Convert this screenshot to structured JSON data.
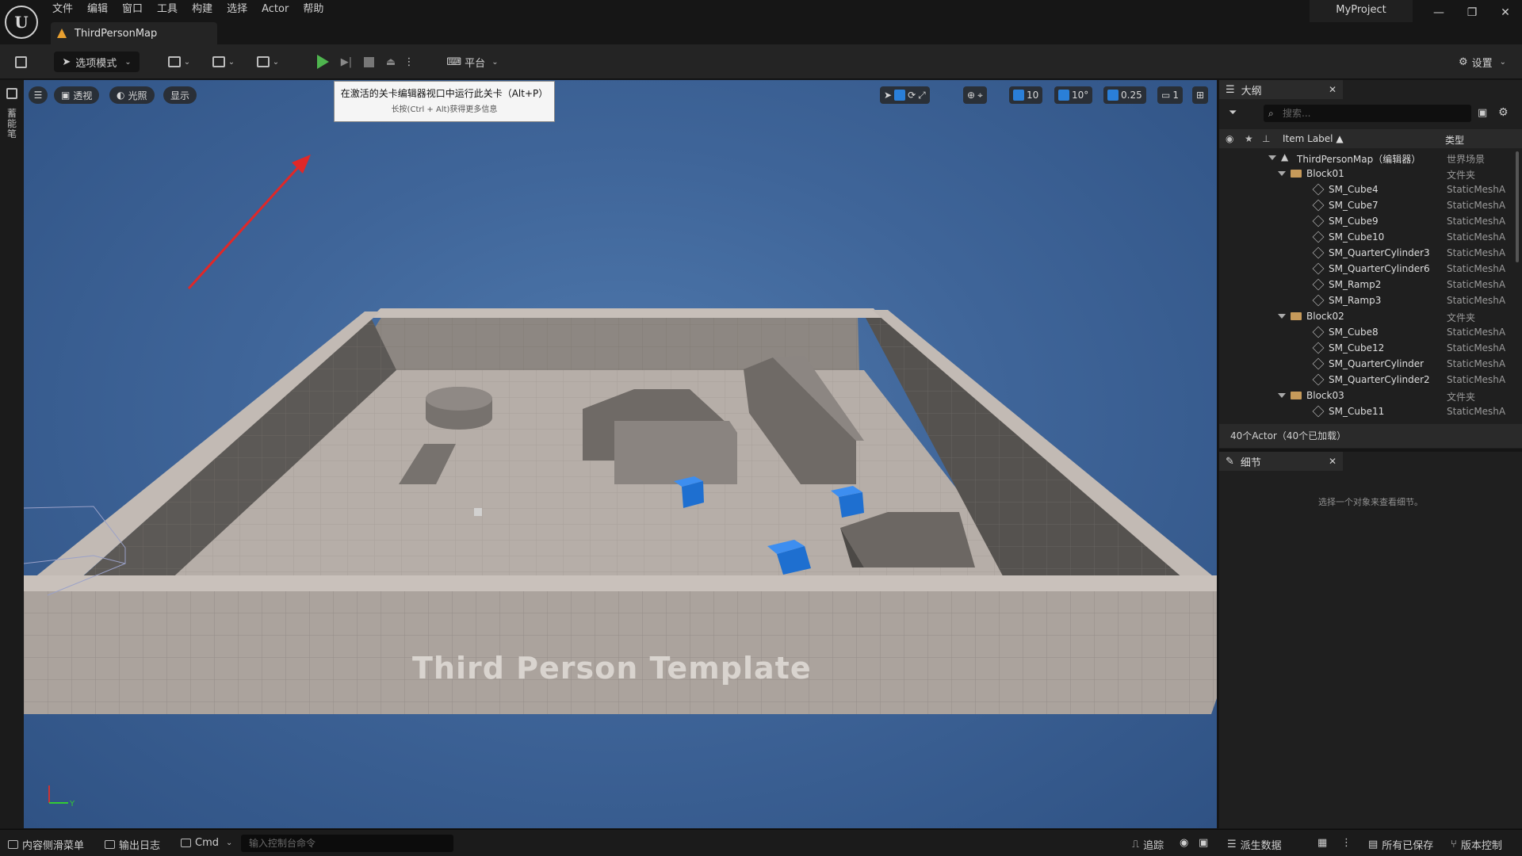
{
  "menubar": {
    "items": [
      "文件",
      "编辑",
      "窗口",
      "工具",
      "构建",
      "选择",
      "Actor",
      "帮助"
    ]
  },
  "tab": {
    "map_name": "ThirdPersonMap"
  },
  "project_name": "MyProject",
  "toolbar": {
    "mode_label": "选项模式",
    "platform_label": "平台",
    "settings_label": "设置"
  },
  "left_strip": {
    "label": "蓄能笔"
  },
  "viewport": {
    "view_mode": "透视",
    "lighting": "光照",
    "show": "显示",
    "grid_snap": "10",
    "rotation_snap": "10°",
    "scale_snap": "0.25",
    "camera_speed": "1",
    "floor_text": "Third Person Template"
  },
  "tooltip": {
    "title": "在激活的关卡编辑器视口中运行此关卡（Alt+P）",
    "hint": "长按(Ctrl + Alt)获得更多信息"
  },
  "outliner": {
    "title": "大纲",
    "search_placeholder": "搜索...",
    "col_label": "Item Label ▲",
    "col_type": "类型",
    "rows": [
      {
        "label": "ThirdPersonMap（编辑器）",
        "type": "世界场景",
        "level": 0,
        "kind": "world"
      },
      {
        "label": "Block01",
        "type": "文件夹",
        "level": 1,
        "kind": "folder"
      },
      {
        "label": "SM_Cube4",
        "type": "StaticMeshA",
        "level": 2,
        "kind": "mesh"
      },
      {
        "label": "SM_Cube7",
        "type": "StaticMeshA",
        "level": 2,
        "kind": "mesh"
      },
      {
        "label": "SM_Cube9",
        "type": "StaticMeshA",
        "level": 2,
        "kind": "mesh"
      },
      {
        "label": "SM_Cube10",
        "type": "StaticMeshA",
        "level": 2,
        "kind": "mesh"
      },
      {
        "label": "SM_QuarterCylinder3",
        "type": "StaticMeshA",
        "level": 2,
        "kind": "mesh"
      },
      {
        "label": "SM_QuarterCylinder6",
        "type": "StaticMeshA",
        "level": 2,
        "kind": "mesh"
      },
      {
        "label": "SM_Ramp2",
        "type": "StaticMeshA",
        "level": 2,
        "kind": "mesh"
      },
      {
        "label": "SM_Ramp3",
        "type": "StaticMeshA",
        "level": 2,
        "kind": "mesh"
      },
      {
        "label": "Block02",
        "type": "文件夹",
        "level": 1,
        "kind": "folder"
      },
      {
        "label": "SM_Cube8",
        "type": "StaticMeshA",
        "level": 2,
        "kind": "mesh"
      },
      {
        "label": "SM_Cube12",
        "type": "StaticMeshA",
        "level": 2,
        "kind": "mesh"
      },
      {
        "label": "SM_QuarterCylinder",
        "type": "StaticMeshA",
        "level": 2,
        "kind": "mesh"
      },
      {
        "label": "SM_QuarterCylinder2",
        "type": "StaticMeshA",
        "level": 2,
        "kind": "mesh"
      },
      {
        "label": "Block03",
        "type": "文件夹",
        "level": 1,
        "kind": "folder"
      },
      {
        "label": "SM_Cube11",
        "type": "StaticMeshA",
        "level": 2,
        "kind": "mesh"
      }
    ],
    "footer": "40个Actor（40个已加载）"
  },
  "details": {
    "title": "细节",
    "empty_message": "选择一个对象来查看细节。"
  },
  "statusbar": {
    "content_drawer": "内容侧滑菜单",
    "output_log": "输出日志",
    "cmd": "Cmd",
    "cmd_placeholder": "输入控制台命令",
    "trace": "追踪",
    "derived_data": "派生数据",
    "all_saved": "所有已保存",
    "source_control": "版本控制"
  },
  "colors": {
    "accent_blue": "#2a7fd8",
    "play_green": "#4fb54f",
    "viewport_sky": "#3f6599",
    "arrow_red": "#e02828"
  }
}
